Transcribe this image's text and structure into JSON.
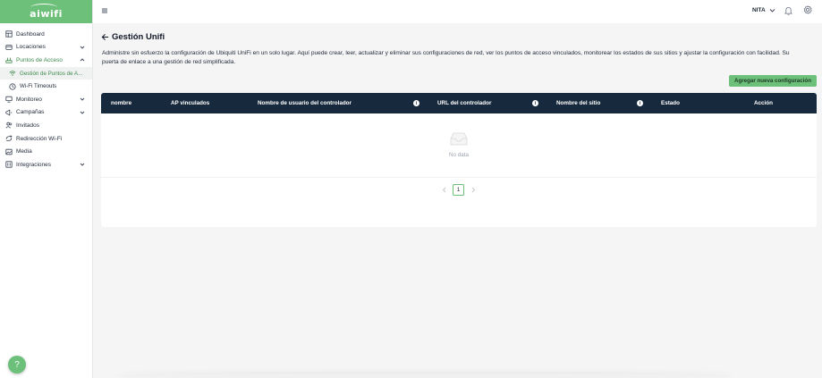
{
  "brand": {
    "name": "aiwifi",
    "color": "#6cc07a"
  },
  "sidebar": {
    "items": [
      {
        "label": "Dashboard",
        "icon": "dashboard-icon"
      },
      {
        "label": "Locaciones",
        "icon": "locations-icon"
      },
      {
        "label": "Puntos de Acceso",
        "icon": "access-point-icon"
      },
      {
        "label": "Monitoreo",
        "icon": "monitor-icon"
      },
      {
        "label": "Campañas",
        "icon": "campaign-icon"
      },
      {
        "label": "Invitados",
        "icon": "guests-icon"
      },
      {
        "label": "Redirección Wi-Fi",
        "icon": "redirect-icon"
      },
      {
        "label": "Media",
        "icon": "media-icon"
      },
      {
        "label": "Integraciones",
        "icon": "integrations-icon"
      }
    ],
    "subitems": [
      {
        "label": "Gestión de Puntos de A...",
        "icon": "wifi-icon"
      },
      {
        "label": "Wi-Fi Timeouts",
        "icon": "clock-icon"
      }
    ]
  },
  "header": {
    "user": "NITA"
  },
  "page": {
    "title": "Gestión Unifi",
    "description": "Administre sin esfuerzo la configuración de Ubiquiti UniFi en un solo lugar. Aquí puede crear, leer, actualizar y eliminar sus configuraciones de red, ver los puntos de acceso vinculados, monitorear los estados de sus sitios y ajustar la configuración con facilidad. Su puerta de enlace a una gestión de red simplificada.",
    "add_button": "Agregar nueva configuración"
  },
  "table": {
    "columns": [
      "nombre",
      "AP vinculados",
      "Nombre de usuario del controlador",
      "URL del controlador",
      "Nombre del sitio",
      "Estado",
      "Acción"
    ],
    "empty_text": "No data",
    "header_bg": "#17293d"
  },
  "pagination": {
    "current": "1"
  },
  "help": {
    "label": "?"
  }
}
